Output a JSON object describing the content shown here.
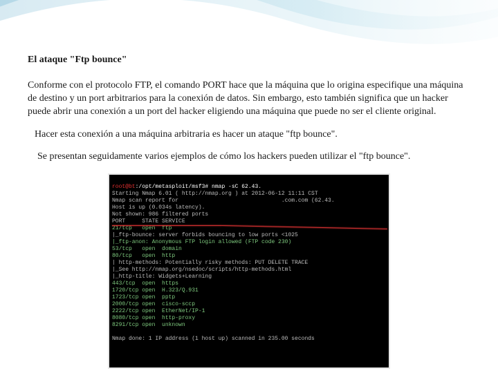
{
  "title": "El ataque \"Ftp bounce\"",
  "para1": " Conforme con el protocolo FTP, el comando PORT hace que la máquina que lo origina especifique una máquina de destino y un port arbitrarios para la conexión de datos. Sin embargo, esto también significa que un hacker puede abrir una conexión a un port del hacker eligiendo una máquina que puede no ser el cliente original.",
  "para2": "Hacer esta conexión a una máquina arbitraria es hacer un ataque \"ftp bounce\".",
  "para3": "Se presentan seguidamente varios ejemplos de cómo los hackers pueden utilizar el \"ftp bounce\".",
  "term": {
    "prompt_user": "root@bt",
    "prompt_path": ":/opt/metasploit/msf3#",
    "prompt_cmd": " nmap -sC 62.43.",
    "l1a": "Starting Nmap 6.01 ( http://nmap.org ) at 2012-06-12 11:11 CST",
    "l2": "Nmap scan report for                               .com.com (62.43.",
    "l3": "Host is up (0.034s latency).",
    "l4": "Not shown: 986 filtered ports",
    "l5": "PORT     STATE SERVICE",
    "r1": "21/tcp   open  ftp",
    "r1b": "|_ftp-bounce: server forbids bouncing to low ports <1025",
    "r1c": "|_ftp-anon: Anonymous FTP login allowed (FTP code 230)",
    "r2": "53/tcp   open  domain",
    "r3": "80/tcp   open  http",
    "r3b": "| http-methods: Potentially risky methods: PUT DELETE TRACE",
    "r3c": "|_See http://nmap.org/nsedoc/scripts/http-methods.html",
    "r3d": "|_http-title: Widgets+Learning",
    "r4": "443/tcp  open  https",
    "r5": "1720/tcp open  H.323/Q.931",
    "r6": "1723/tcp open  pptp",
    "r7": "2000/tcp open  cisco-sccp",
    "r8": "2222/tcp open  EtherNet/IP-1",
    "r9": "8080/tcp open  http-proxy",
    "r10": "8291/tcp open  unknown",
    "done": "Nmap done: 1 IP address (1 host up) scanned in 235.00 seconds"
  }
}
